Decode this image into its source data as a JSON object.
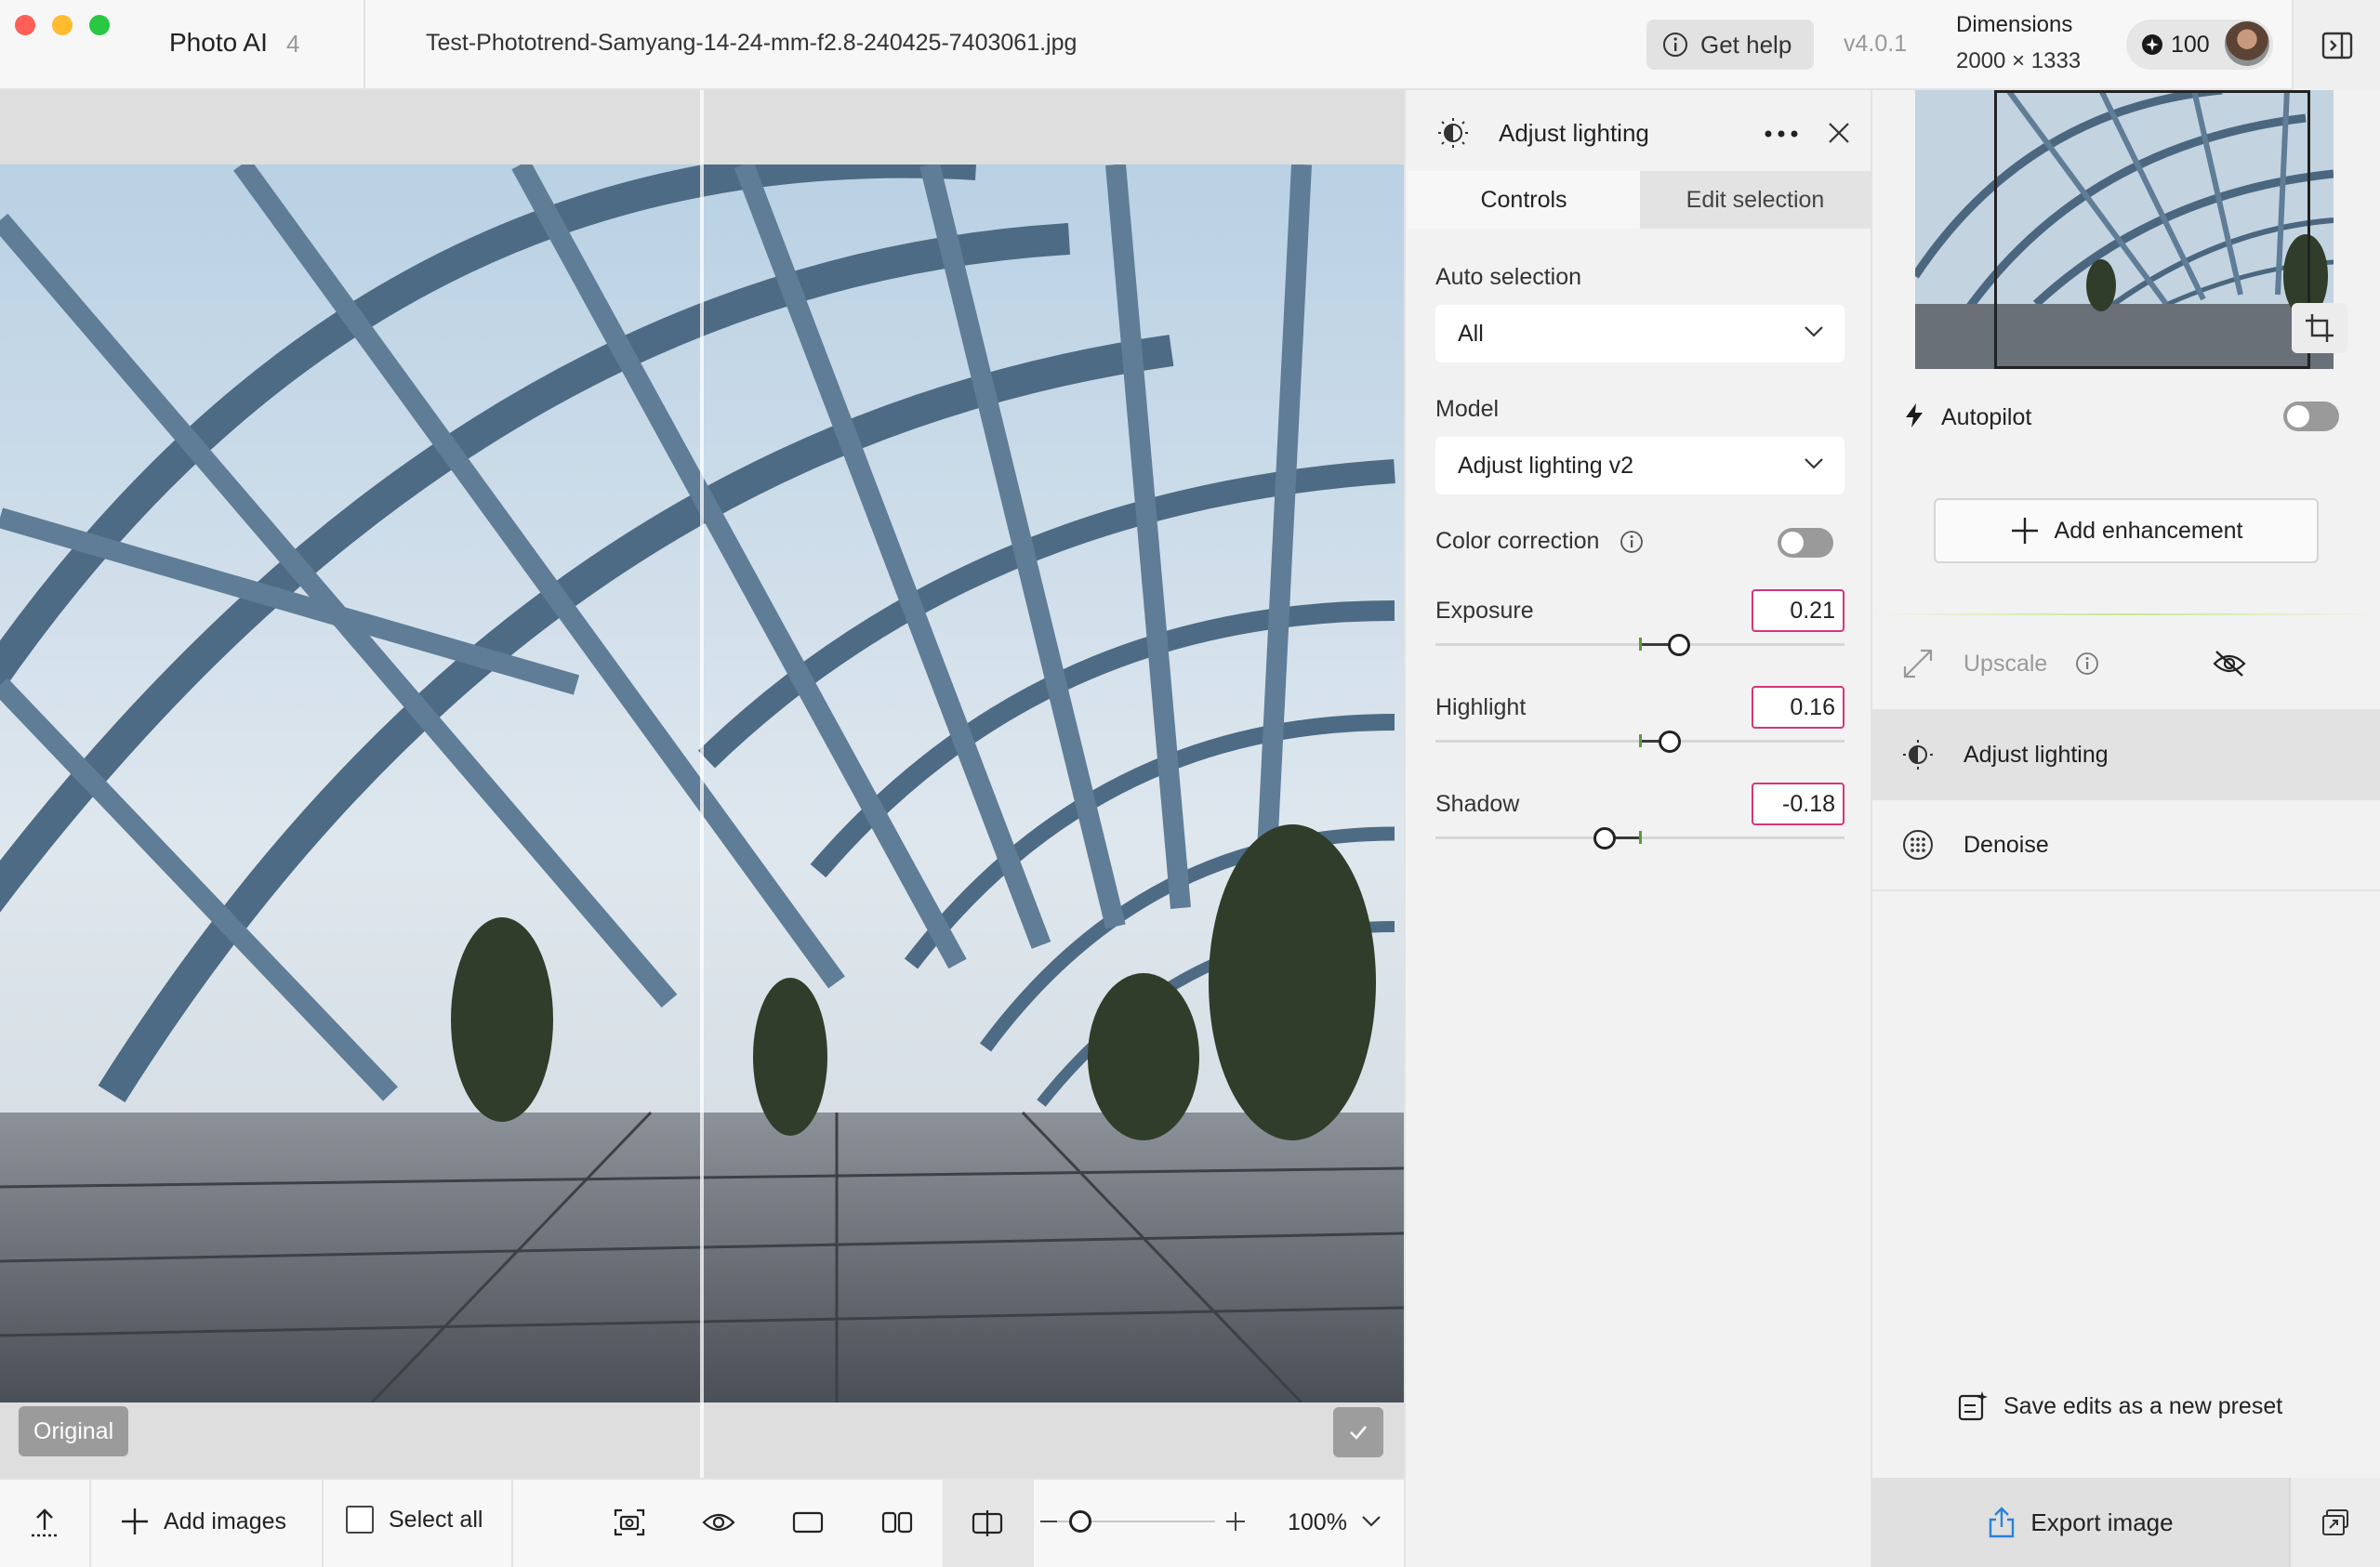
{
  "titlebar": {
    "app_name": "Photo AI",
    "app_version_badge": "4",
    "filename": "Test-Phototrend-Samyang-14-24-mm-f2.8-240425-7403061.jpg",
    "help_label": "Get help",
    "version": "v4.0.1",
    "dimensions_label": "Dimensions",
    "dimensions_value": "2000 × 1333",
    "credits": "100",
    "colors": {
      "close": "#ff5f57",
      "minimize": "#febc2e",
      "zoom": "#28c840"
    }
  },
  "canvas": {
    "original_badge": "Original"
  },
  "bottombar": {
    "add_images": "Add images",
    "select_all": "Select all",
    "zoom": "100%"
  },
  "panel": {
    "title": "Adjust lighting",
    "tabs": [
      {
        "label": "Controls",
        "active": true
      },
      {
        "label": "Edit selection",
        "active": false
      }
    ],
    "auto_selection_label": "Auto selection",
    "auto_selection_value": "All",
    "model_label": "Model",
    "model_value": "Adjust lighting v2",
    "color_correction_label": "Color correction",
    "color_correction_on": false,
    "sliders": [
      {
        "label": "Exposure",
        "value": "0.21"
      },
      {
        "label": "Highlight",
        "value": "0.16"
      },
      {
        "label": "Shadow",
        "value": "-0.18"
      }
    ],
    "accent_color": "#d4367a"
  },
  "sidebar": {
    "autopilot_label": "Autopilot",
    "autopilot_on": false,
    "add_enhancement": "Add enhancement",
    "enhancements": [
      {
        "label": "Upscale",
        "state": "hidden",
        "icon": "expand-arrows-icon"
      },
      {
        "label": "Adjust lighting",
        "state": "selected",
        "icon": "lighting-icon"
      },
      {
        "label": "Denoise",
        "state": "normal",
        "icon": "denoise-grid-icon"
      }
    ],
    "save_preset": "Save edits as a new preset",
    "export": "Export image"
  }
}
